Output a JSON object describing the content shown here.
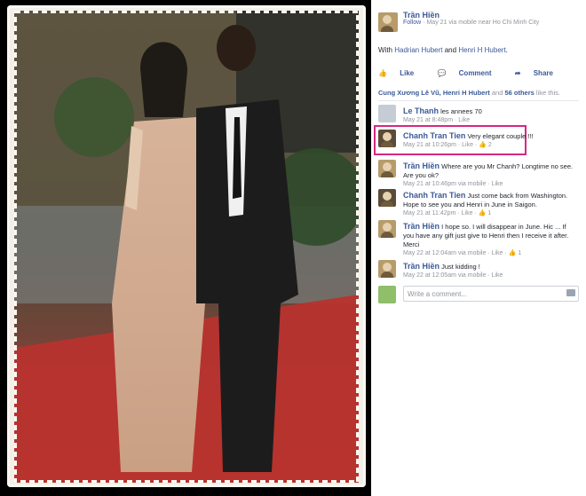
{
  "post": {
    "author": "Trần Hiền",
    "follow": "Follow",
    "meta": "May 21 via mobile near Ho Chi Minh City",
    "with_text": "With",
    "with_names": [
      "Hadrian Hubert",
      "Henri H Hubert"
    ],
    "and": "and"
  },
  "actions": {
    "like": "Like",
    "comment": "Comment",
    "share": "Share"
  },
  "likes": {
    "names": "Cung Xương Lê Vũ, Henri H Hubert",
    "and_text": "and",
    "others": "56 others",
    "tail": "like this."
  },
  "comments": [
    {
      "name": "Le Thanh",
      "text": "les annees 70",
      "meta": "May 21 at 8:48pm · Like",
      "likes": ""
    },
    {
      "name": "Chanh Tran Tien",
      "text": "Very elegant couple !!!",
      "meta": "May 21 at 10:26pm · Like ·",
      "likes": "2"
    },
    {
      "name": "Trần Hiền",
      "text": "Where are you Mr Chanh? Longtime no see. Are you ok?",
      "meta": "May 21 at 10:46pm via mobile · Like",
      "likes": ""
    },
    {
      "name": "Chanh Tran Tien",
      "text": "Just come back from Washington. Hope to see you and Henri in June in Saigon.",
      "meta": "May 21 at 11:42pm · Like ·",
      "likes": "1"
    },
    {
      "name": "Trần Hiền",
      "text": "I hope so. I will disappear in June. Hic ... If you have any gift just give to Henri then I receive it after. Merci",
      "meta": "May 22 at 12:04am via mobile · Like ·",
      "likes": "1"
    },
    {
      "name": "Trần Hiền",
      "text": "Just kidding !",
      "meta": "May 22 at 12:05am via mobile · Like",
      "likes": ""
    }
  ],
  "compose": {
    "placeholder": "Write a comment..."
  }
}
